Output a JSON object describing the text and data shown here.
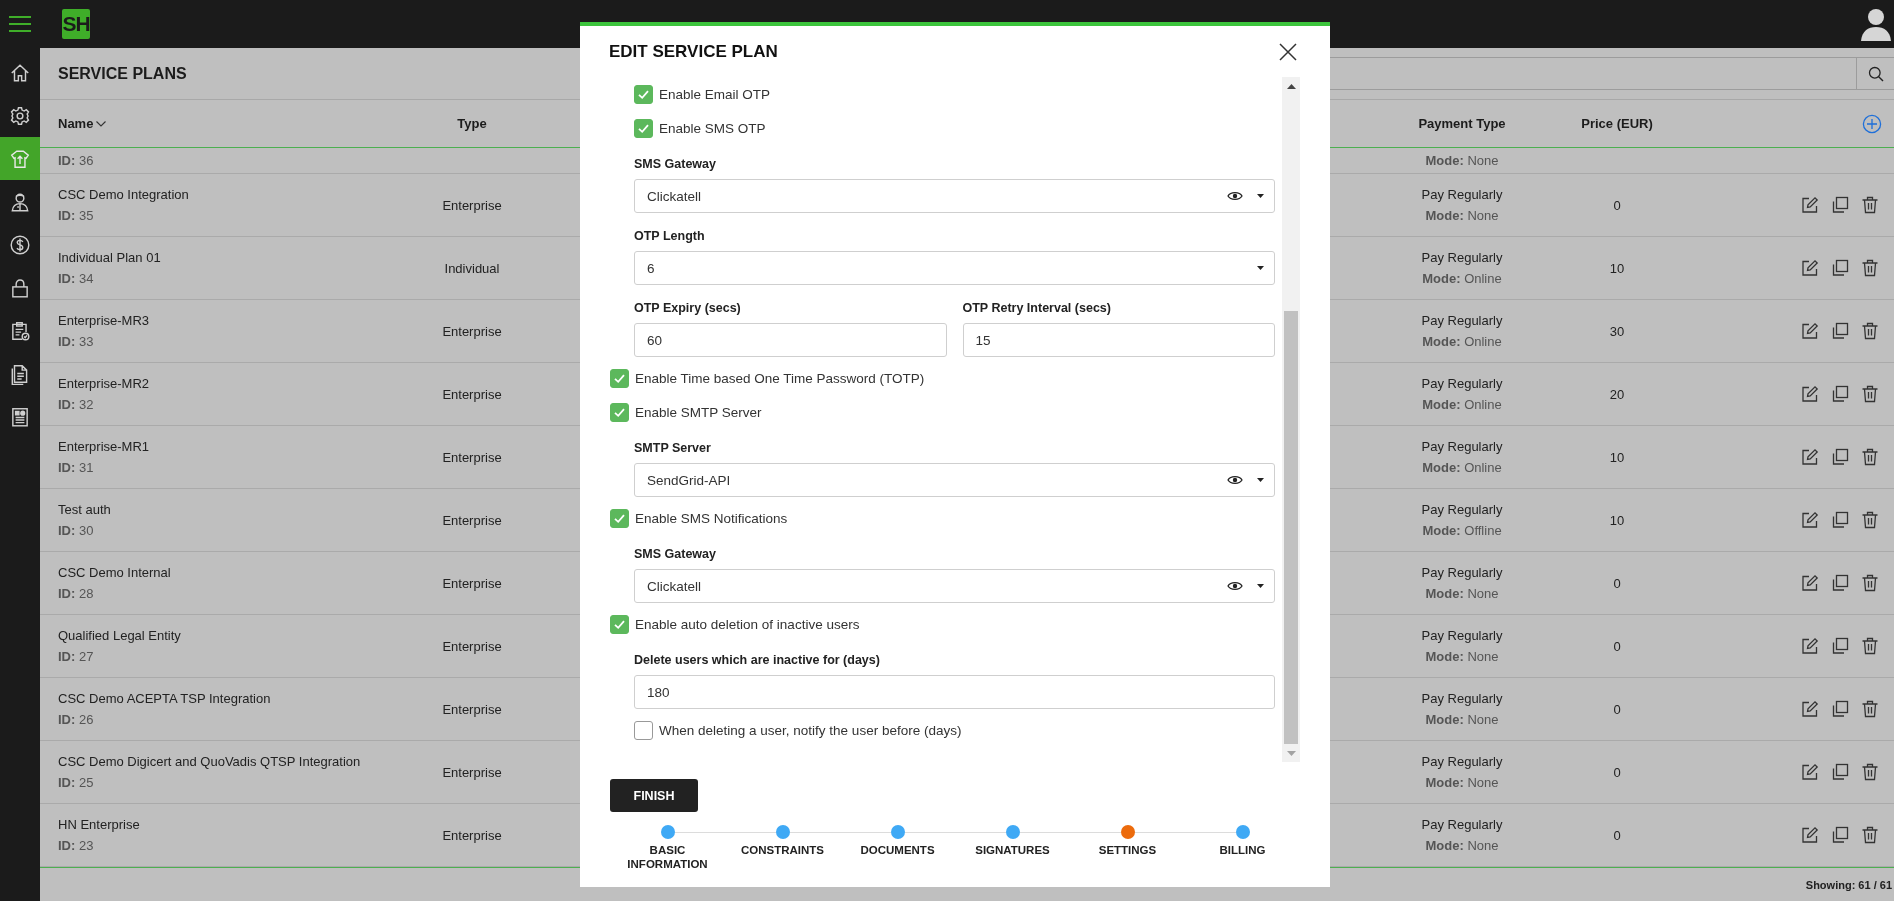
{
  "top_bar": {
    "logo": "SH"
  },
  "sidebar": {
    "items": [
      {
        "kind": "home",
        "selected": false
      },
      {
        "kind": "settings",
        "selected": false
      },
      {
        "kind": "upload",
        "selected": true
      },
      {
        "kind": "person",
        "selected": false
      },
      {
        "kind": "dollar",
        "selected": false
      },
      {
        "kind": "lock",
        "selected": false
      },
      {
        "kind": "clipboard",
        "selected": false
      },
      {
        "kind": "document",
        "selected": false
      },
      {
        "kind": "report",
        "selected": false
      }
    ]
  },
  "page": {
    "title": "SERVICE PLANS"
  },
  "table": {
    "columns": [
      {
        "label": "Name",
        "sorted": true
      },
      {
        "label": "Type"
      },
      {
        "label": "Payment Type"
      },
      {
        "label": "Price (EUR)"
      }
    ],
    "partial_row": {
      "id": "**ID:** 36",
      "mode": "**Mode:** None"
    },
    "rows": [
      {
        "name": "CSC Demo Integration",
        "id": "**ID:** 35",
        "type": "Enterprise",
        "payment": "Pay Regularly",
        "mode": "**Mode:** None",
        "price": "0"
      },
      {
        "name": "Individual Plan 01",
        "id": "**ID:** 34",
        "type": "Individual",
        "payment": "Pay Regularly",
        "mode": "**Mode:** Online",
        "price": "10"
      },
      {
        "name": "Enterprise-MR3",
        "id": "**ID:** 33",
        "type": "Enterprise",
        "payment": "Pay Regularly",
        "mode": "**Mode:** Online",
        "price": "30"
      },
      {
        "name": "Enterprise-MR2",
        "id": "**ID:** 32",
        "type": "Enterprise",
        "payment": "Pay Regularly",
        "mode": "**Mode:** Online",
        "price": "20"
      },
      {
        "name": "Enterprise-MR1",
        "id": "**ID:** 31",
        "type": "Enterprise",
        "payment": "Pay Regularly",
        "mode": "**Mode:** Online",
        "price": "10"
      },
      {
        "name": "Test auth",
        "id": "**ID:** 30",
        "type": "Enterprise",
        "payment": "Pay Regularly",
        "mode": "**Mode:** Offline",
        "price": "10"
      },
      {
        "name": "CSC Demo Internal",
        "id": "**ID:** 28",
        "type": "Enterprise",
        "payment": "Pay Regularly",
        "mode": "**Mode:** None",
        "price": "0"
      },
      {
        "name": "Qualified Legal Entity",
        "id": "**ID:** 27",
        "type": "Enterprise",
        "payment": "Pay Regularly",
        "mode": "**Mode:** None",
        "price": "0"
      },
      {
        "name": "CSC Demo ACEPTA TSP Integration",
        "id": "**ID:** 26",
        "type": "Enterprise",
        "payment": "Pay Regularly",
        "mode": "**Mode:** None",
        "price": "0"
      },
      {
        "name": "CSC Demo Digicert and QuoVadis QTSP Integration",
        "id": "**ID:** 25",
        "type": "Enterprise",
        "payment": "Pay Regularly",
        "mode": "**Mode:** None",
        "price": "0"
      },
      {
        "name": "HN Enterprise",
        "id": "**ID:** 23",
        "type": "Enterprise",
        "payment": "Pay Regularly",
        "mode": "**Mode:** None",
        "price": "0"
      }
    ]
  },
  "footer": {
    "showing": "Showing: 61 / 61"
  },
  "dialog": {
    "title": "EDIT SERVICE PLAN",
    "settings": [
      {
        "kind": "group",
        "children": [
          {
            "kind": "checkbox",
            "label": "Enable Email OTP",
            "checked": true
          },
          {
            "kind": "checkbox",
            "label": "Enable SMS OTP",
            "checked": true
          },
          {
            "kind": "select",
            "label": "SMS Gateway",
            "value": "Clickatell",
            "reveal": true
          },
          {
            "kind": "select",
            "label": "OTP Length",
            "value": "6",
            "reveal": false
          },
          {
            "kind": "row",
            "children": [
              {
                "kind": "input",
                "label": "OTP Expiry (secs)",
                "value": "60"
              },
              {
                "kind": "input",
                "label": "OTP Retry Interval (secs)",
                "value": "15"
              }
            ]
          }
        ]
      },
      {
        "kind": "checkbox",
        "label": "Enable Time based One Time Password (TOTP)",
        "checked": true
      },
      {
        "kind": "checkbox",
        "label": "Enable SMTP Server",
        "checked": true,
        "children": [
          {
            "kind": "select",
            "label": "SMTP Server",
            "value": "SendGrid-API",
            "reveal": true
          }
        ]
      },
      {
        "kind": "checkbox",
        "label": "Enable SMS Notifications",
        "checked": true,
        "children": [
          {
            "kind": "select",
            "label": "SMS Gateway",
            "value": "Clickatell",
            "reveal": true
          }
        ]
      },
      {
        "kind": "checkbox",
        "label": "Enable auto deletion of inactive users",
        "checked": true,
        "children": [
          {
            "kind": "input",
            "label": "Delete users which are inactive for (days)",
            "value": "180"
          },
          {
            "kind": "checkbox",
            "label": "When deleting a user, notify the user before (days)",
            "checked": false
          }
        ]
      }
    ],
    "button": "FINISH",
    "steps": [
      {
        "label": "BASIC INFORMATION",
        "selected": false
      },
      {
        "label": "CONSTRAINTS",
        "selected": false
      },
      {
        "label": "DOCUMENTS",
        "selected": false
      },
      {
        "label": "SIGNATURES",
        "selected": false
      },
      {
        "label": "SETTINGS",
        "selected": true
      },
      {
        "label": "BILLING",
        "selected": false
      }
    ]
  }
}
